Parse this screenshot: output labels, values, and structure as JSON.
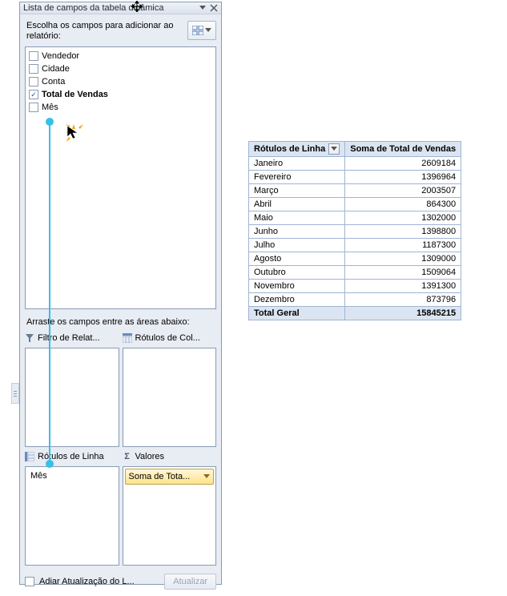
{
  "panel": {
    "title": "Lista de campos da tabela dinâmica",
    "choose_label": "Escolha os campos para adicionar ao relatório:",
    "fields": [
      {
        "label": "Vendedor",
        "checked": false
      },
      {
        "label": "Cidade",
        "checked": false
      },
      {
        "label": "Conta",
        "checked": false
      },
      {
        "label": "Total de Vendas",
        "checked": true,
        "bold": true
      },
      {
        "label": "Mês",
        "checked": false
      }
    ],
    "drag_label": "Arraste os campos entre as áreas abaixo:",
    "areas": {
      "filter": "Filtro de Relat...",
      "columns": "Rótulos de Col...",
      "rows": "Rótulos de Linha",
      "values": "Valores"
    },
    "row_chip": "Mês",
    "value_chip": "Soma de Tota...",
    "defer_label": "Adiar Atualização do L...",
    "update_label": "Atualizar"
  },
  "pivot": {
    "row_header": "Rótulos de Linha",
    "value_header": "Soma de Total de Vendas",
    "rows": [
      {
        "label": "Janeiro",
        "value": "2609184"
      },
      {
        "label": "Fevereiro",
        "value": "1396964"
      },
      {
        "label": "Março",
        "value": "2003507"
      },
      {
        "label": "Abril",
        "value": "864300"
      },
      {
        "label": "Maio",
        "value": "1302000"
      },
      {
        "label": "Junho",
        "value": "1398800"
      },
      {
        "label": "Julho",
        "value": "1187300"
      },
      {
        "label": "Agosto",
        "value": "1309000"
      },
      {
        "label": "Outubro",
        "value": "1509064"
      },
      {
        "label": "Novembro",
        "value": "1391300"
      },
      {
        "label": "Dezembro",
        "value": "873796"
      }
    ],
    "total_label": "Total Geral",
    "total_value": "15845215"
  },
  "sigma": "Σ"
}
